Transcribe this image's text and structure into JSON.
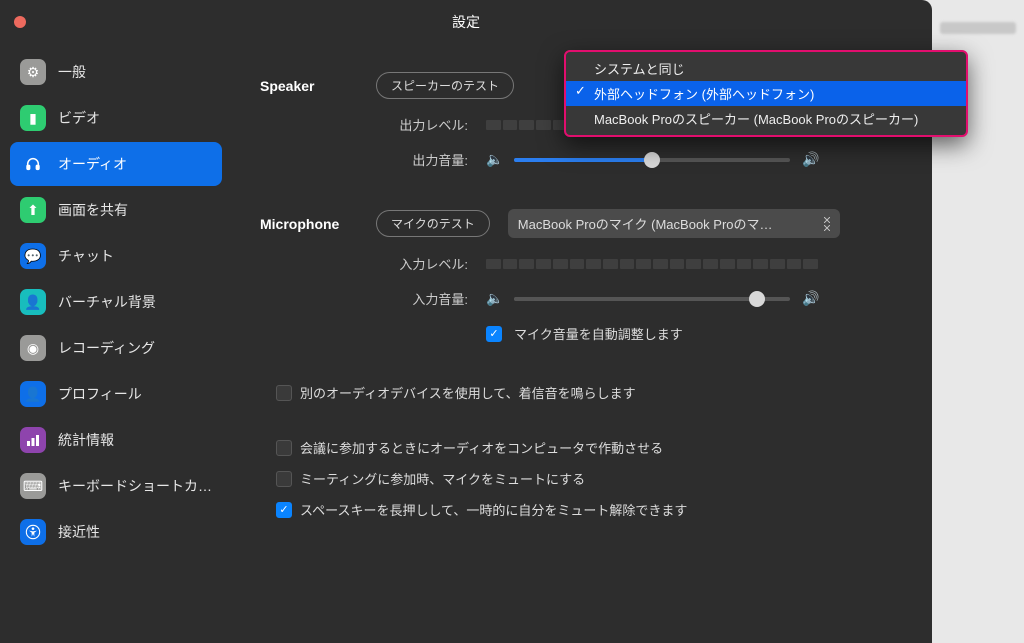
{
  "window": {
    "title": "設定"
  },
  "sidebar": {
    "items": [
      {
        "label": "一般"
      },
      {
        "label": "ビデオ"
      },
      {
        "label": "オーディオ"
      },
      {
        "label": "画面を共有"
      },
      {
        "label": "チャット"
      },
      {
        "label": "バーチャル背景"
      },
      {
        "label": "レコーディング"
      },
      {
        "label": "プロフィール"
      },
      {
        "label": "統計情報"
      },
      {
        "label": "キーボードショートカ…"
      },
      {
        "label": "接近性"
      }
    ]
  },
  "speaker": {
    "heading": "Speaker",
    "test_label": "スピーカーのテスト",
    "output_level_label": "出力レベル:",
    "output_volume_label": "出力音量:",
    "volume_percent": 50,
    "dropdown": {
      "options": [
        "システムと同じ",
        "外部ヘッドフォン (外部ヘッドフォン)",
        "MacBook Proのスピーカー (MacBook Proのスピーカー)"
      ],
      "selected_index": 1,
      "highlight_index": 1
    }
  },
  "microphone": {
    "heading": "Microphone",
    "test_label": "マイクのテスト",
    "selected": "MacBook Proのマイク (MacBook Proのマ…",
    "input_level_label": "入力レベル:",
    "input_volume_label": "入力音量:",
    "volume_percent": 88,
    "auto_adjust_label": "マイク音量を自動調整します",
    "auto_adjust_checked": true
  },
  "options": {
    "ringtone_label": "別のオーディオデバイスを使用して、着信音を鳴らします",
    "ringtone_checked": false,
    "join_audio_label": "会議に参加するときにオーディオをコンピュータで作動させる",
    "join_audio_checked": false,
    "mute_on_join_label": "ミーティングに参加時、マイクをミュートにする",
    "mute_on_join_checked": false,
    "space_unmute_label": "スペースキーを長押しして、一時的に自分をミュート解除できます",
    "space_unmute_checked": true
  }
}
